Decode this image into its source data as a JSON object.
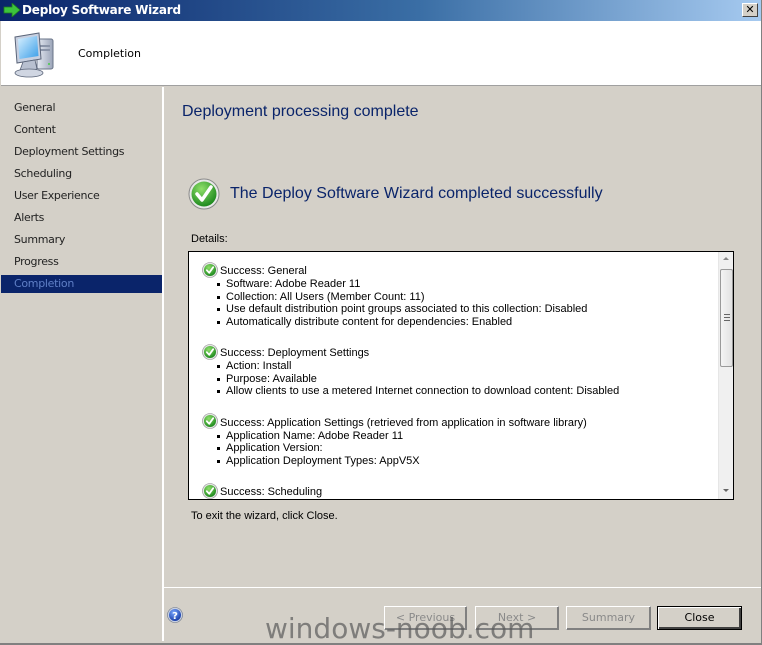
{
  "window": {
    "title": "Deploy Software Wizard",
    "close_glyph": "✕"
  },
  "header": {
    "title": "Completion"
  },
  "sidebar": {
    "items": [
      {
        "label": "General",
        "active": false
      },
      {
        "label": "Content",
        "active": false
      },
      {
        "label": "Deployment Settings",
        "active": false
      },
      {
        "label": "Scheduling",
        "active": false
      },
      {
        "label": "User Experience",
        "active": false
      },
      {
        "label": "Alerts",
        "active": false
      },
      {
        "label": "Summary",
        "active": false
      },
      {
        "label": "Progress",
        "active": false
      },
      {
        "label": "Completion",
        "active": true
      }
    ]
  },
  "main": {
    "page_title": "Deployment processing complete",
    "success_message": "The Deploy Software Wizard completed successfully",
    "details_label": "Details:",
    "details": [
      {
        "title": "Success: General",
        "items": [
          "Software: Adobe Reader 11",
          "Collection: All Users (Member Count: 11)",
          "Use default distribution point groups associated to this collection: Disabled",
          "Automatically distribute content for dependencies: Enabled"
        ]
      },
      {
        "title": "Success: Deployment Settings",
        "items": [
          "Action: Install",
          "Purpose: Available",
          "Allow clients to use a metered Internet connection to download content: Disabled"
        ]
      },
      {
        "title": "Success: Application Settings (retrieved from application in software library)",
        "items": [
          "Application Name: Adobe Reader 11",
          "Application Version:",
          "Application Deployment Types: AppV5X"
        ]
      },
      {
        "title": "Success: Scheduling",
        "items": []
      }
    ],
    "exit_text": "To exit the wizard, click Close."
  },
  "footer": {
    "previous_label": "< Previous",
    "next_label": "Next >",
    "summary_label": "Summary",
    "close_label": "Close"
  },
  "watermark": "windows-noob.com",
  "colors": {
    "accent": "#0a246a",
    "title_text": "#0a246a",
    "success_green": "#3aa53a"
  }
}
